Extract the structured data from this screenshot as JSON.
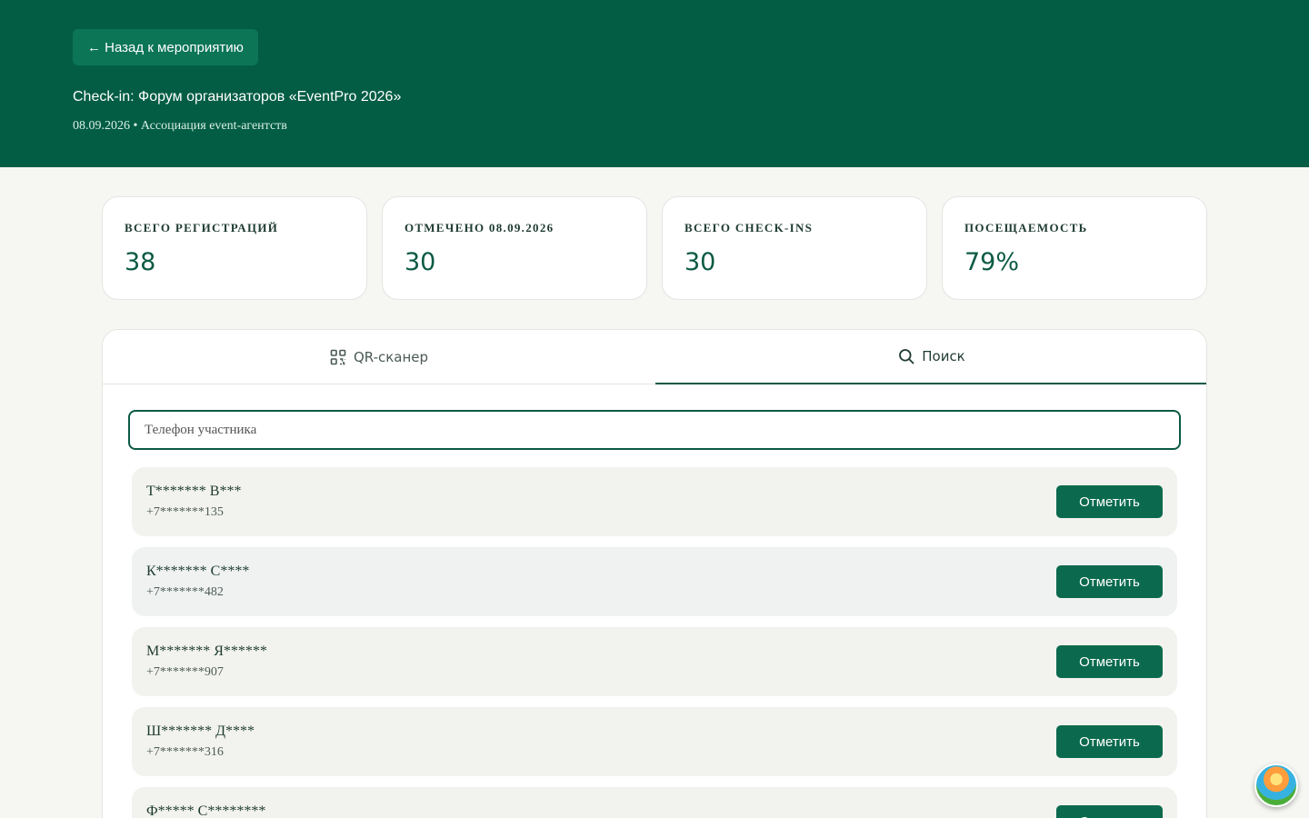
{
  "header": {
    "back_label": "← Назад к мероприятию",
    "title": "Check-in: Форум организаторов «EventPro 2026»",
    "subtitle": "08.09.2026 • Ассоциация event-агентств"
  },
  "stats": [
    {
      "label": "Всего регистраций",
      "value": "38"
    },
    {
      "label": "Отмечено 08.09.2026",
      "value": "30"
    },
    {
      "label": "Всего check-ins",
      "value": "30"
    },
    {
      "label": "Посещаемость",
      "value": "79%"
    }
  ],
  "tabs": [
    {
      "label": "QR-сканер",
      "icon": "qr-code-icon",
      "active": false
    },
    {
      "label": "Поиск",
      "icon": "search-icon",
      "active": true
    }
  ],
  "search": {
    "placeholder": "Телефон участника",
    "value": ""
  },
  "attendees": [
    {
      "name": "Т******* В***",
      "phone": "+7*******135",
      "action": "Отметить"
    },
    {
      "name": "К******* С****",
      "phone": "+7*******482",
      "action": "Отметить"
    },
    {
      "name": "М******* Я******",
      "phone": "+7*******907",
      "action": "Отметить"
    },
    {
      "name": "Ш******* Д****",
      "phone": "+7*******316",
      "action": "Отметить"
    },
    {
      "name": "Ф***** С********",
      "phone": "",
      "action": "Отметить"
    }
  ],
  "colors": {
    "brand": "#025d44",
    "accent": "#0b6a4d"
  },
  "fab_icon": "assistant-avatar-icon"
}
